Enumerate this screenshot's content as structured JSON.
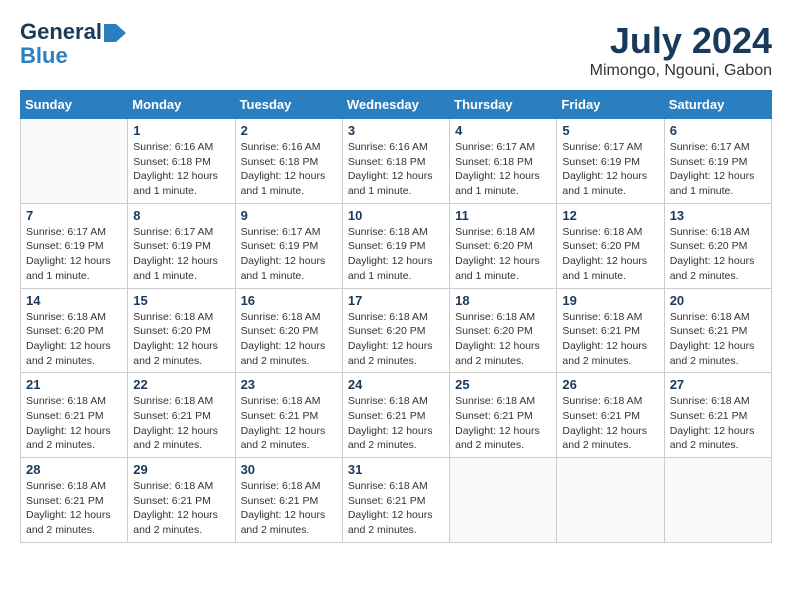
{
  "logo": {
    "line1": "General",
    "line2": "Blue"
  },
  "title": "July 2024",
  "location": "Mimongo, Ngouni, Gabon",
  "weekdays": [
    "Sunday",
    "Monday",
    "Tuesday",
    "Wednesday",
    "Thursday",
    "Friday",
    "Saturday"
  ],
  "weeks": [
    [
      {
        "day": "",
        "info": ""
      },
      {
        "day": "1",
        "info": "Sunrise: 6:16 AM\nSunset: 6:18 PM\nDaylight: 12 hours\nand 1 minute."
      },
      {
        "day": "2",
        "info": "Sunrise: 6:16 AM\nSunset: 6:18 PM\nDaylight: 12 hours\nand 1 minute."
      },
      {
        "day": "3",
        "info": "Sunrise: 6:16 AM\nSunset: 6:18 PM\nDaylight: 12 hours\nand 1 minute."
      },
      {
        "day": "4",
        "info": "Sunrise: 6:17 AM\nSunset: 6:18 PM\nDaylight: 12 hours\nand 1 minute."
      },
      {
        "day": "5",
        "info": "Sunrise: 6:17 AM\nSunset: 6:19 PM\nDaylight: 12 hours\nand 1 minute."
      },
      {
        "day": "6",
        "info": "Sunrise: 6:17 AM\nSunset: 6:19 PM\nDaylight: 12 hours\nand 1 minute."
      }
    ],
    [
      {
        "day": "7",
        "info": "Sunrise: 6:17 AM\nSunset: 6:19 PM\nDaylight: 12 hours\nand 1 minute."
      },
      {
        "day": "8",
        "info": "Sunrise: 6:17 AM\nSunset: 6:19 PM\nDaylight: 12 hours\nand 1 minute."
      },
      {
        "day": "9",
        "info": "Sunrise: 6:17 AM\nSunset: 6:19 PM\nDaylight: 12 hours\nand 1 minute."
      },
      {
        "day": "10",
        "info": "Sunrise: 6:18 AM\nSunset: 6:19 PM\nDaylight: 12 hours\nand 1 minute."
      },
      {
        "day": "11",
        "info": "Sunrise: 6:18 AM\nSunset: 6:20 PM\nDaylight: 12 hours\nand 1 minute."
      },
      {
        "day": "12",
        "info": "Sunrise: 6:18 AM\nSunset: 6:20 PM\nDaylight: 12 hours\nand 1 minute."
      },
      {
        "day": "13",
        "info": "Sunrise: 6:18 AM\nSunset: 6:20 PM\nDaylight: 12 hours\nand 2 minutes."
      }
    ],
    [
      {
        "day": "14",
        "info": "Sunrise: 6:18 AM\nSunset: 6:20 PM\nDaylight: 12 hours\nand 2 minutes."
      },
      {
        "day": "15",
        "info": "Sunrise: 6:18 AM\nSunset: 6:20 PM\nDaylight: 12 hours\nand 2 minutes."
      },
      {
        "day": "16",
        "info": "Sunrise: 6:18 AM\nSunset: 6:20 PM\nDaylight: 12 hours\nand 2 minutes."
      },
      {
        "day": "17",
        "info": "Sunrise: 6:18 AM\nSunset: 6:20 PM\nDaylight: 12 hours\nand 2 minutes."
      },
      {
        "day": "18",
        "info": "Sunrise: 6:18 AM\nSunset: 6:20 PM\nDaylight: 12 hours\nand 2 minutes."
      },
      {
        "day": "19",
        "info": "Sunrise: 6:18 AM\nSunset: 6:21 PM\nDaylight: 12 hours\nand 2 minutes."
      },
      {
        "day": "20",
        "info": "Sunrise: 6:18 AM\nSunset: 6:21 PM\nDaylight: 12 hours\nand 2 minutes."
      }
    ],
    [
      {
        "day": "21",
        "info": "Sunrise: 6:18 AM\nSunset: 6:21 PM\nDaylight: 12 hours\nand 2 minutes."
      },
      {
        "day": "22",
        "info": "Sunrise: 6:18 AM\nSunset: 6:21 PM\nDaylight: 12 hours\nand 2 minutes."
      },
      {
        "day": "23",
        "info": "Sunrise: 6:18 AM\nSunset: 6:21 PM\nDaylight: 12 hours\nand 2 minutes."
      },
      {
        "day": "24",
        "info": "Sunrise: 6:18 AM\nSunset: 6:21 PM\nDaylight: 12 hours\nand 2 minutes."
      },
      {
        "day": "25",
        "info": "Sunrise: 6:18 AM\nSunset: 6:21 PM\nDaylight: 12 hours\nand 2 minutes."
      },
      {
        "day": "26",
        "info": "Sunrise: 6:18 AM\nSunset: 6:21 PM\nDaylight: 12 hours\nand 2 minutes."
      },
      {
        "day": "27",
        "info": "Sunrise: 6:18 AM\nSunset: 6:21 PM\nDaylight: 12 hours\nand 2 minutes."
      }
    ],
    [
      {
        "day": "28",
        "info": "Sunrise: 6:18 AM\nSunset: 6:21 PM\nDaylight: 12 hours\nand 2 minutes."
      },
      {
        "day": "29",
        "info": "Sunrise: 6:18 AM\nSunset: 6:21 PM\nDaylight: 12 hours\nand 2 minutes."
      },
      {
        "day": "30",
        "info": "Sunrise: 6:18 AM\nSunset: 6:21 PM\nDaylight: 12 hours\nand 2 minutes."
      },
      {
        "day": "31",
        "info": "Sunrise: 6:18 AM\nSunset: 6:21 PM\nDaylight: 12 hours\nand 2 minutes."
      },
      {
        "day": "",
        "info": ""
      },
      {
        "day": "",
        "info": ""
      },
      {
        "day": "",
        "info": ""
      }
    ]
  ]
}
